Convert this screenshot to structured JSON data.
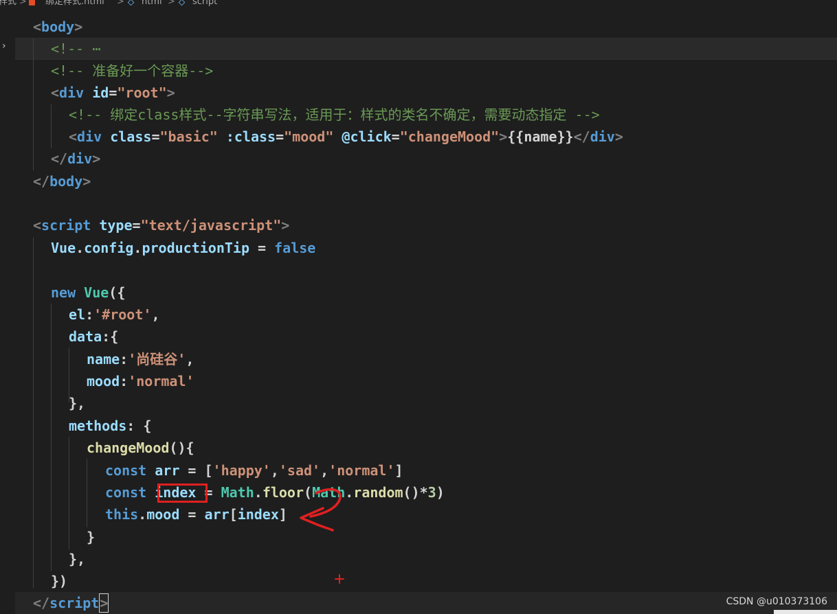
{
  "breadcrumb": {
    "segments": [
      "样式",
      "绑定样式.html",
      "html",
      "script"
    ],
    "separator": ">"
  },
  "code": {
    "lines": {
      "l1_tag": "<body>",
      "l2_comment_start": "<!-- ",
      "l2_ellipsis": "⋯",
      "l3_comment": "<!-- 准备好一个容器-->",
      "l4_open": "<div ",
      "l4_attr": "id",
      "l4_eq": "=",
      "l4_val": "\"root\"",
      "l4_close": ">",
      "l5_comment": "<!-- 绑定class样式--字符串写法，适用于：样式的类名不确定，需要动态指定 -->",
      "l6_open": "<div ",
      "l6_attr1": "class",
      "l6_val1": "\"basic\"",
      "l6_attr2": ":class",
      "l6_val2": "\"mood\"",
      "l6_attr3": "@click",
      "l6_val3": "\"changeMood\"",
      "l6_text": "{{name}}",
      "l6_end": "</div>",
      "l7_tag": "</div>",
      "l8_tag": "</body>",
      "l10_open": "<script ",
      "l10_attr": "type",
      "l10_val": "\"text/javascript\"",
      "l10_close": ">",
      "l11_vue": "Vue",
      "l11_config": "config",
      "l11_prop": "productionTip",
      "l11_false": "false",
      "l13_new": "new ",
      "l13_vue": "Vue",
      "l13_rest": "({",
      "l14_key": "el",
      "l14_val": "'#root'",
      "l15_key": "data",
      "l16_key": "name",
      "l16_val": "'尚硅谷'",
      "l17_key": "mood",
      "l17_val": "'normal'",
      "l18": "},",
      "l19_key": "methods",
      "l20_fn": "changeMood",
      "l21_const": "const ",
      "l21_var": "arr",
      "l21_s1": "'happy'",
      "l21_s2": "'sad'",
      "l21_s3": "'normal'",
      "l22_const": "const ",
      "l22_var": "index",
      "l22_math": "Math",
      "l22_floor": "floor",
      "l22_math2": "Math",
      "l22_random": "random",
      "l22_num": "3",
      "l23_this": "this",
      "l23_mood": "mood",
      "l23_arr": "arr",
      "l23_index": "index",
      "l24": "}",
      "l25": "},",
      "l26": "})",
      "l27_tag": "</script",
      "l27_close": ">"
    }
  },
  "watermark": "CSDN @u010373106",
  "colors": {
    "background": "#1e1e1e",
    "tag": "#569cd6",
    "attribute": "#9cdcfe",
    "string": "#ce9178",
    "comment": "#6a9955",
    "function": "#dcdcaa",
    "class": "#4ec9b0",
    "number": "#b5cea8",
    "annotation": "#e02020"
  }
}
